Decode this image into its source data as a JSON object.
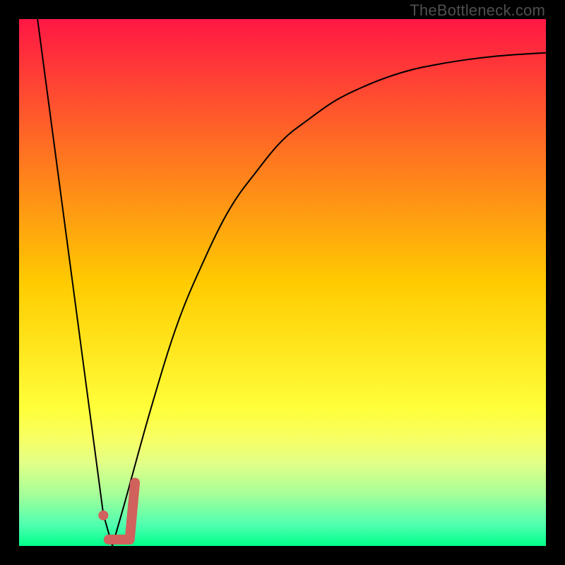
{
  "watermark": "TheBottleneck.com",
  "chart_data": {
    "type": "line",
    "title": "",
    "xlabel": "",
    "ylabel": "",
    "xlim": [
      0,
      100
    ],
    "ylim": [
      0,
      100
    ],
    "grid": false,
    "legend": false,
    "background_gradient": {
      "stops": [
        {
          "pos": 0.0,
          "color": "#ff1744"
        },
        {
          "pos": 0.5,
          "color": "#ffcb00"
        },
        {
          "pos": 0.74,
          "color": "#ffff3a"
        },
        {
          "pos": 0.8,
          "color": "#f6ff66"
        },
        {
          "pos": 0.84,
          "color": "#e4ff85"
        },
        {
          "pos": 0.9,
          "color": "#a8ff98"
        },
        {
          "pos": 0.96,
          "color": "#4fffb0"
        },
        {
          "pos": 1.0,
          "color": "#00ff8a"
        }
      ]
    },
    "series": [
      {
        "name": "bottleneck-curve",
        "type": "line",
        "color": "#000000",
        "width": 2,
        "points": [
          {
            "x": 3.5,
            "y": 100.0
          },
          {
            "x": 16.0,
            "y": 6.0
          },
          {
            "x": 17.7,
            "y": 0.0
          },
          {
            "x": 20.0,
            "y": 8.0
          },
          {
            "x": 25.0,
            "y": 26.0
          },
          {
            "x": 30.0,
            "y": 42.0
          },
          {
            "x": 35.0,
            "y": 54.0
          },
          {
            "x": 40.0,
            "y": 64.0
          },
          {
            "x": 45.0,
            "y": 71.0
          },
          {
            "x": 50.0,
            "y": 77.0
          },
          {
            "x": 55.0,
            "y": 81.0
          },
          {
            "x": 60.0,
            "y": 84.5
          },
          {
            "x": 65.0,
            "y": 87.0
          },
          {
            "x": 70.0,
            "y": 89.0
          },
          {
            "x": 75.0,
            "y": 90.5
          },
          {
            "x": 80.0,
            "y": 91.5
          },
          {
            "x": 85.0,
            "y": 92.3
          },
          {
            "x": 90.0,
            "y": 92.9
          },
          {
            "x": 95.0,
            "y": 93.3
          },
          {
            "x": 100.0,
            "y": 93.6
          }
        ]
      },
      {
        "name": "highlight-segment",
        "type": "line",
        "color": "#d1615c",
        "width": 14,
        "linecap": "round",
        "points": [
          {
            "x": 17.0,
            "y": 1.2
          },
          {
            "x": 21.0,
            "y": 1.2
          },
          {
            "x": 22.0,
            "y": 12.0
          }
        ]
      },
      {
        "name": "marker-point",
        "type": "scatter",
        "color": "#d1615c",
        "radius": 7,
        "points": [
          {
            "x": 16.0,
            "y": 5.8
          }
        ]
      }
    ]
  }
}
